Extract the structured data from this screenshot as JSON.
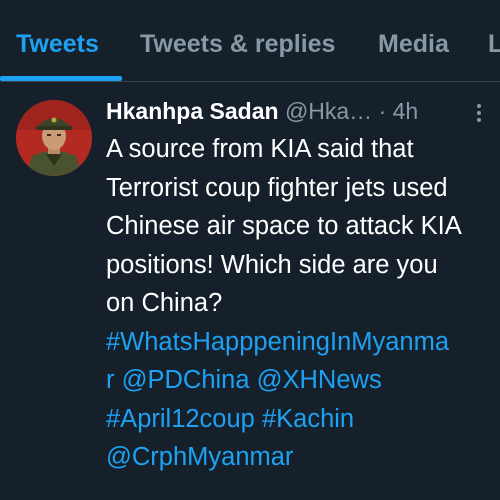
{
  "tabs": [
    {
      "label": "Tweets",
      "active": true
    },
    {
      "label": "Tweets & replies",
      "active": false
    },
    {
      "label": "Media",
      "active": false
    },
    {
      "label": "L",
      "active": false
    }
  ],
  "tweet": {
    "display_name": "Hkanhpa Sadan",
    "handle": "@Hka…",
    "separator": "·",
    "time": "4h",
    "text_lines": [
      "A source from KIA said that",
      "Terrorist coup fighter jets used",
      "Chinese air space to attack KIA",
      "positions! Which side are you",
      "on China?"
    ],
    "tags": {
      "line1": "#WhatsHapppeningInMyanma",
      "line2_a": "r",
      "line2_b": "@PDChina",
      "line2_c": "@XHNews",
      "line3_a": "#April12coup",
      "line3_b": "#Kachin",
      "line4": "@CrphMyanmar"
    }
  },
  "colors": {
    "background": "#15202b",
    "accent": "#1da1f2",
    "muted": "#8899a6",
    "divider": "#38444d"
  },
  "icons": {
    "more": "more-vertical-icon",
    "avatar": "profile-avatar"
  }
}
